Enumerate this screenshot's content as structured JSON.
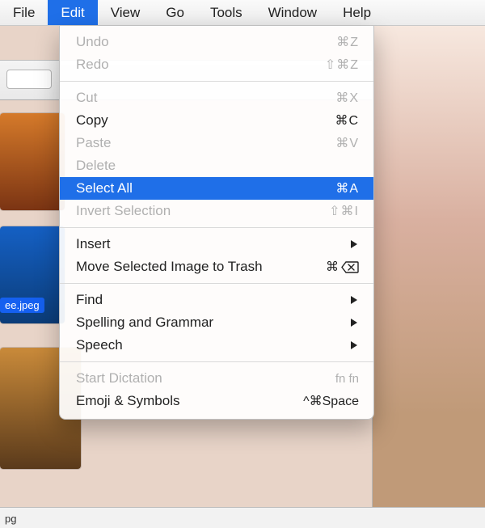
{
  "menubar": {
    "items": [
      {
        "label": "File",
        "active": false
      },
      {
        "label": "Edit",
        "active": true
      },
      {
        "label": "View",
        "active": false
      },
      {
        "label": "Go",
        "active": false
      },
      {
        "label": "Tools",
        "active": false
      },
      {
        "label": "Window",
        "active": false
      },
      {
        "label": "Help",
        "active": false
      }
    ]
  },
  "dropdown": {
    "groups": [
      [
        {
          "label": "Undo",
          "shortcut": "⌘Z",
          "disabled": true
        },
        {
          "label": "Redo",
          "shortcut": "⇧⌘Z",
          "disabled": true
        }
      ],
      [
        {
          "label": "Cut",
          "shortcut": "⌘X",
          "disabled": true
        },
        {
          "label": "Copy",
          "shortcut": "⌘C",
          "disabled": false
        },
        {
          "label": "Paste",
          "shortcut": "⌘V",
          "disabled": true
        },
        {
          "label": "Delete",
          "shortcut": "",
          "disabled": true
        },
        {
          "label": "Select All",
          "shortcut": "⌘A",
          "disabled": false,
          "selected": true
        },
        {
          "label": "Invert Selection",
          "shortcut": "⇧⌘I",
          "disabled": true
        }
      ],
      [
        {
          "label": "Insert",
          "submenu": true,
          "disabled": false
        },
        {
          "label": "Move Selected Image to Trash",
          "shortcut": "⌘",
          "trash_icon": true,
          "disabled": false
        }
      ],
      [
        {
          "label": "Find",
          "submenu": true,
          "disabled": false
        },
        {
          "label": "Spelling and Grammar",
          "submenu": true,
          "disabled": false
        },
        {
          "label": "Speech",
          "submenu": true,
          "disabled": false
        }
      ],
      [
        {
          "label": "Start Dictation",
          "shortcut": "fn fn",
          "disabled": true
        },
        {
          "label": "Emoji & Symbols",
          "shortcut": "^⌘Space",
          "disabled": false
        }
      ]
    ]
  },
  "background": {
    "selected_file_label": "ee.jpeg",
    "bottom_label": "pg"
  }
}
